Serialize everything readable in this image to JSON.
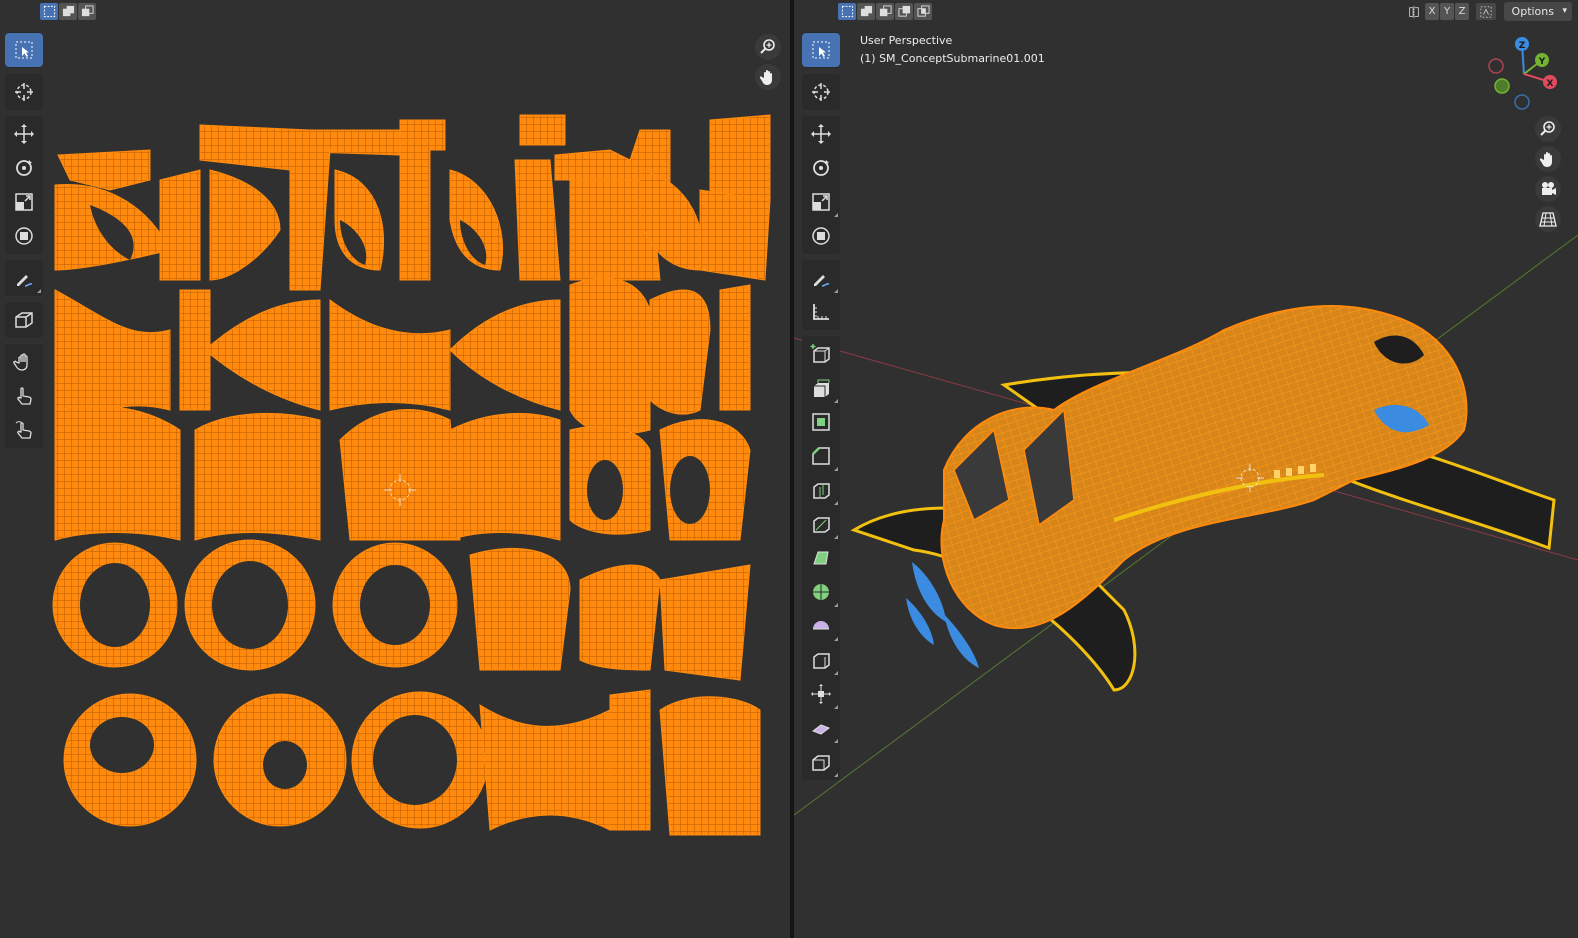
{
  "uv_editor": {
    "header": {
      "select_modes": [
        "select-new-icon",
        "select-extend-icon",
        "select-subtract-icon"
      ]
    },
    "tools": [
      "select-box-icon",
      "cursor-icon",
      "move-icon",
      "rotate-icon",
      "scale-icon",
      "transform-icon",
      "annotate-icon",
      "box-icon",
      "grab-icon",
      "pinch-icon",
      "relax-icon"
    ],
    "nav": [
      "zoom-icon",
      "pan-icon"
    ]
  },
  "viewport": {
    "view_name": "User Perspective",
    "object_name": "(1) SM_ConceptSubmarine01.001",
    "axis_labels": [
      "X",
      "Y",
      "Z"
    ],
    "options_label": "Options",
    "gizmo_labels": {
      "z": "Z",
      "y": "Y",
      "x": "X"
    },
    "colors": {
      "accent": "#4772b3",
      "uv": "#ff8a0d",
      "axis_x": "#e04b5f",
      "axis_y": "#74b32f",
      "axis_z": "#3b8be0"
    }
  }
}
